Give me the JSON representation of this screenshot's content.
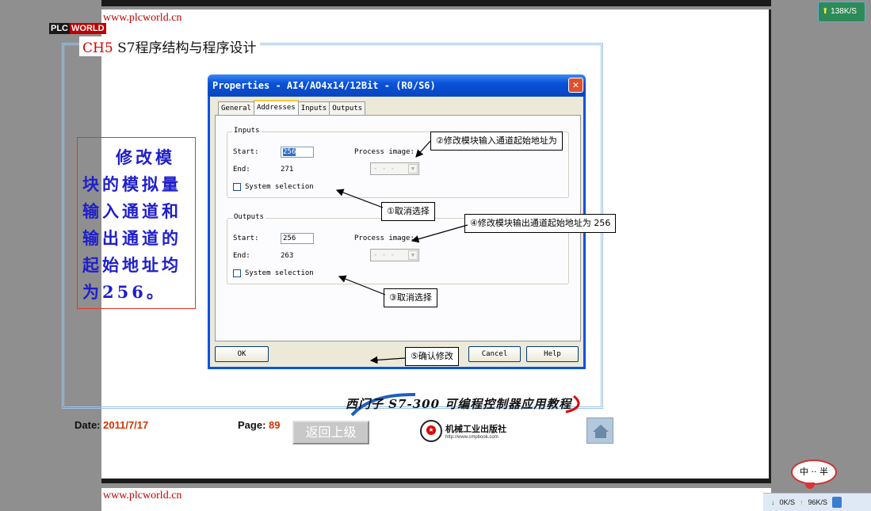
{
  "viewer": {
    "site_url": "www.plcworld.cn",
    "site_url_next": "www.plcworld.cn"
  },
  "slide": {
    "logo_left": "PLC",
    "logo_right": "WORLD",
    "chapter": "CH5",
    "title": "S7程序结构与程序设计",
    "side_note": "修改模块的模拟量输入通道和输出通道的起始地址均为256。",
    "footer": {
      "date_label": "Date:",
      "date_value": "2011/7/17",
      "page_label": "Page:",
      "page_value": "89",
      "back_label": "返回上级",
      "book_title": "西门子 S7-300 可编程控制器应用教程",
      "publisher_name": "机械工业出版社",
      "publisher_url": "http://www.cmpbook.com"
    }
  },
  "dialog": {
    "title": "Properties - AI4/AO4x14/12Bit - (R0/S6)",
    "close": "✕",
    "tabs": [
      "General",
      "Addresses",
      "Inputs",
      "Outputs"
    ],
    "active_tab": "Addresses",
    "inputs": {
      "legend": "Inputs",
      "start_label": "Start:",
      "start_value": "256",
      "end_label": "End:",
      "end_value": "271",
      "process_image_label": "Process image:",
      "process_image_value": "- - -",
      "system_selection_label": "System selection"
    },
    "outputs": {
      "legend": "Outputs",
      "start_label": "Start:",
      "start_value": "256",
      "end_label": "End:",
      "end_value": "263",
      "process_image_label": "Process image:",
      "process_image_value": "- - -",
      "system_selection_label": "System selection"
    },
    "buttons": {
      "ok": "OK",
      "cancel": "Cancel",
      "help": "Help"
    }
  },
  "callouts": {
    "c1": "①取消选择",
    "c2": "②修改模块输入通道起始地址为",
    "c3": "③取消选择",
    "c4": "④修改模块输出通道起始地址为 256",
    "c5": "⑤确认修改"
  },
  "system": {
    "speed_badge": "138K/S",
    "ime": "中 ·· 半",
    "down_speed": "0K/S",
    "up_speed": "96K/S"
  },
  "colors": {
    "accent_red": "#c00000",
    "note_blue": "#1e1ecc",
    "xp_titlebar": "#0a52d8"
  }
}
